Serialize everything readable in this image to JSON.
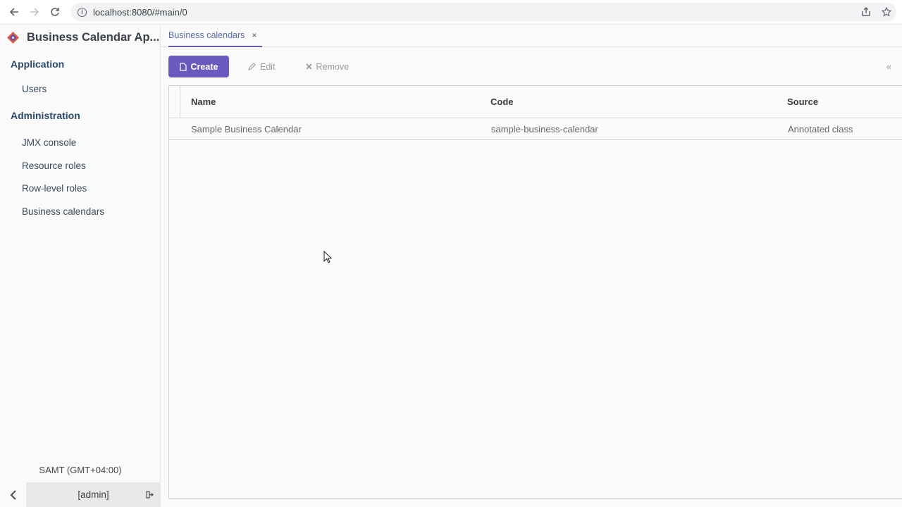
{
  "browser": {
    "url": "localhost:8080/#main/0",
    "info_glyph": "i"
  },
  "sidebar": {
    "app_title": "Business Calendar Ap...",
    "groups": [
      {
        "label": "Application",
        "items": [
          {
            "label": "Users"
          }
        ]
      },
      {
        "label": "Administration",
        "items": [
          {
            "label": "JMX console"
          },
          {
            "label": "Resource roles"
          },
          {
            "label": "Row-level roles"
          },
          {
            "label": "Business calendars"
          }
        ]
      }
    ],
    "timezone": "SAMT (GMT+04:00)",
    "user": "[admin]"
  },
  "tabs": [
    {
      "label": "Business calendars",
      "close": "×"
    }
  ],
  "toolbar": {
    "create_label": "Create",
    "edit_label": "Edit",
    "remove_label": "Remove",
    "collapse_glyph": "«"
  },
  "table": {
    "columns": [
      "Name",
      "Code",
      "Source"
    ],
    "rows": [
      [
        "Sample Business Calendar",
        "sample-business-calendar",
        "Annotated class"
      ]
    ]
  },
  "colors": {
    "accent": "#6a5ac0",
    "group_text": "#2b4b6c"
  }
}
